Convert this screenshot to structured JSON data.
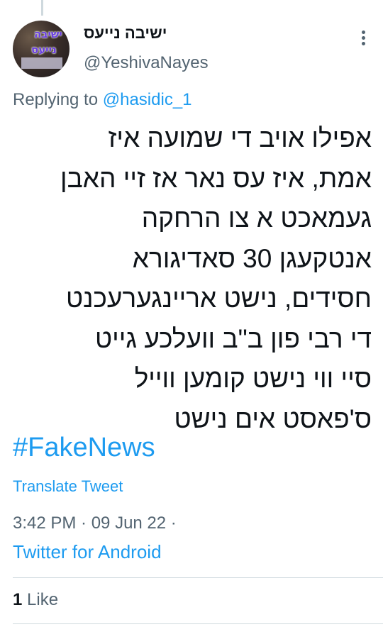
{
  "tweet": {
    "author": {
      "display_name": "ישיבה נייעס",
      "handle": "@YeshivaNayes",
      "avatar_text_top": "ישיבה",
      "avatar_text_bottom": "נייעס"
    },
    "reply_prefix": "Replying to",
    "reply_to": "@hasidic_1",
    "lines": [
      "אפילו אויב די שמועה איז",
      "אמת, איז עס נאר אז זיי האבן",
      "געמאכט א צו הרחקה",
      "אנטקעגן 30 סאדיגורא",
      "חסידים, נישט אריינגערעכנט",
      "די רבי פון ב\"ב וועלכע גייט",
      "סיי ווי נישט קומען ווייל",
      "ס'פאסט אים נישט"
    ],
    "hashtag": "#FakeNews",
    "translate_label": "Translate Tweet",
    "timestamp": "3:42 PM · 09 Jun 22 ·",
    "source": "Twitter for Android",
    "likes_count": "1",
    "likes_label": "Like"
  },
  "icons": {
    "more": "more-vertical-icon"
  },
  "colors": {
    "link": "#1d9bf0",
    "text": "#0f1419",
    "secondary": "#536471",
    "divider": "#cfd9de"
  }
}
